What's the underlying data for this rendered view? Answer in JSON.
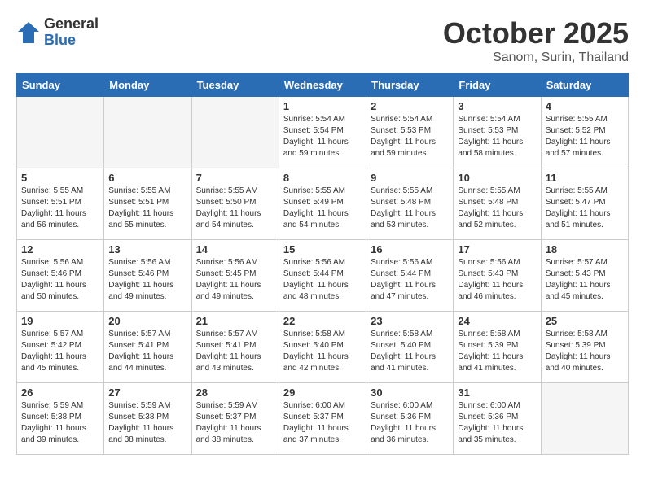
{
  "header": {
    "logo_general": "General",
    "logo_blue": "Blue",
    "month": "October 2025",
    "location": "Sanom, Surin, Thailand"
  },
  "days_of_week": [
    "Sunday",
    "Monday",
    "Tuesday",
    "Wednesday",
    "Thursday",
    "Friday",
    "Saturday"
  ],
  "weeks": [
    [
      {
        "day": "",
        "info": ""
      },
      {
        "day": "",
        "info": ""
      },
      {
        "day": "",
        "info": ""
      },
      {
        "day": "1",
        "info": "Sunrise: 5:54 AM\nSunset: 5:54 PM\nDaylight: 11 hours\nand 59 minutes."
      },
      {
        "day": "2",
        "info": "Sunrise: 5:54 AM\nSunset: 5:53 PM\nDaylight: 11 hours\nand 59 minutes."
      },
      {
        "day": "3",
        "info": "Sunrise: 5:54 AM\nSunset: 5:53 PM\nDaylight: 11 hours\nand 58 minutes."
      },
      {
        "day": "4",
        "info": "Sunrise: 5:55 AM\nSunset: 5:52 PM\nDaylight: 11 hours\nand 57 minutes."
      }
    ],
    [
      {
        "day": "5",
        "info": "Sunrise: 5:55 AM\nSunset: 5:51 PM\nDaylight: 11 hours\nand 56 minutes."
      },
      {
        "day": "6",
        "info": "Sunrise: 5:55 AM\nSunset: 5:51 PM\nDaylight: 11 hours\nand 55 minutes."
      },
      {
        "day": "7",
        "info": "Sunrise: 5:55 AM\nSunset: 5:50 PM\nDaylight: 11 hours\nand 54 minutes."
      },
      {
        "day": "8",
        "info": "Sunrise: 5:55 AM\nSunset: 5:49 PM\nDaylight: 11 hours\nand 54 minutes."
      },
      {
        "day": "9",
        "info": "Sunrise: 5:55 AM\nSunset: 5:48 PM\nDaylight: 11 hours\nand 53 minutes."
      },
      {
        "day": "10",
        "info": "Sunrise: 5:55 AM\nSunset: 5:48 PM\nDaylight: 11 hours\nand 52 minutes."
      },
      {
        "day": "11",
        "info": "Sunrise: 5:55 AM\nSunset: 5:47 PM\nDaylight: 11 hours\nand 51 minutes."
      }
    ],
    [
      {
        "day": "12",
        "info": "Sunrise: 5:56 AM\nSunset: 5:46 PM\nDaylight: 11 hours\nand 50 minutes."
      },
      {
        "day": "13",
        "info": "Sunrise: 5:56 AM\nSunset: 5:46 PM\nDaylight: 11 hours\nand 49 minutes."
      },
      {
        "day": "14",
        "info": "Sunrise: 5:56 AM\nSunset: 5:45 PM\nDaylight: 11 hours\nand 49 minutes."
      },
      {
        "day": "15",
        "info": "Sunrise: 5:56 AM\nSunset: 5:44 PM\nDaylight: 11 hours\nand 48 minutes."
      },
      {
        "day": "16",
        "info": "Sunrise: 5:56 AM\nSunset: 5:44 PM\nDaylight: 11 hours\nand 47 minutes."
      },
      {
        "day": "17",
        "info": "Sunrise: 5:56 AM\nSunset: 5:43 PM\nDaylight: 11 hours\nand 46 minutes."
      },
      {
        "day": "18",
        "info": "Sunrise: 5:57 AM\nSunset: 5:43 PM\nDaylight: 11 hours\nand 45 minutes."
      }
    ],
    [
      {
        "day": "19",
        "info": "Sunrise: 5:57 AM\nSunset: 5:42 PM\nDaylight: 11 hours\nand 45 minutes."
      },
      {
        "day": "20",
        "info": "Sunrise: 5:57 AM\nSunset: 5:41 PM\nDaylight: 11 hours\nand 44 minutes."
      },
      {
        "day": "21",
        "info": "Sunrise: 5:57 AM\nSunset: 5:41 PM\nDaylight: 11 hours\nand 43 minutes."
      },
      {
        "day": "22",
        "info": "Sunrise: 5:58 AM\nSunset: 5:40 PM\nDaylight: 11 hours\nand 42 minutes."
      },
      {
        "day": "23",
        "info": "Sunrise: 5:58 AM\nSunset: 5:40 PM\nDaylight: 11 hours\nand 41 minutes."
      },
      {
        "day": "24",
        "info": "Sunrise: 5:58 AM\nSunset: 5:39 PM\nDaylight: 11 hours\nand 41 minutes."
      },
      {
        "day": "25",
        "info": "Sunrise: 5:58 AM\nSunset: 5:39 PM\nDaylight: 11 hours\nand 40 minutes."
      }
    ],
    [
      {
        "day": "26",
        "info": "Sunrise: 5:59 AM\nSunset: 5:38 PM\nDaylight: 11 hours\nand 39 minutes."
      },
      {
        "day": "27",
        "info": "Sunrise: 5:59 AM\nSunset: 5:38 PM\nDaylight: 11 hours\nand 38 minutes."
      },
      {
        "day": "28",
        "info": "Sunrise: 5:59 AM\nSunset: 5:37 PM\nDaylight: 11 hours\nand 38 minutes."
      },
      {
        "day": "29",
        "info": "Sunrise: 6:00 AM\nSunset: 5:37 PM\nDaylight: 11 hours\nand 37 minutes."
      },
      {
        "day": "30",
        "info": "Sunrise: 6:00 AM\nSunset: 5:36 PM\nDaylight: 11 hours\nand 36 minutes."
      },
      {
        "day": "31",
        "info": "Sunrise: 6:00 AM\nSunset: 5:36 PM\nDaylight: 11 hours\nand 35 minutes."
      },
      {
        "day": "",
        "info": ""
      }
    ]
  ]
}
